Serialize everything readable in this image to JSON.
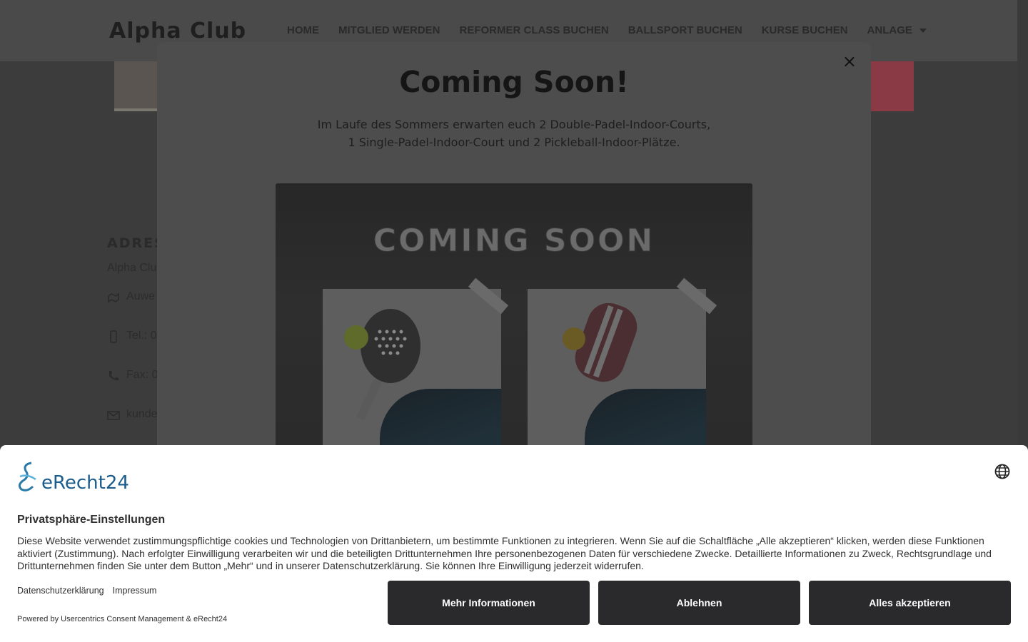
{
  "site": {
    "logo": "Alpha Club",
    "nav": [
      {
        "label": "HOME"
      },
      {
        "label": "MITGLIED WERDEN"
      },
      {
        "label": "REFORMER CLASS BUCHEN"
      },
      {
        "label": "BALLSPORT BUCHEN"
      },
      {
        "label": "KURSE BUCHEN"
      },
      {
        "label": "ANLAGE"
      }
    ],
    "address": {
      "title": "ADRES",
      "name": "Alpha Clu",
      "street": "Auwe",
      "tel": "Tel.: 0",
      "fax": "Fax: 0",
      "email": "kunde"
    }
  },
  "modal": {
    "close": "×",
    "title": "Coming Soon!",
    "text_line1": "Im Laufe des Sommers erwarten euch 2 Double-Padel-Indoor-Courts,",
    "text_line2": "1 Single-Padel-Indoor-Court und 2 Pickleball-Indoor-Plätze.",
    "promo_title": "COMING SOON"
  },
  "cookie": {
    "brand": "eRecht24",
    "heading": "Privatsphäre-Einstellungen",
    "body": "Diese Website verwendet zustimmungspflichtige cookies und Technologien von Drittanbietern, um bestimmte Funktionen zu integrieren. Wenn Sie auf die Schaltfläche „Alle akzeptieren“ klicken, werden diese Funktionen aktiviert (Zustimmung). Nach erfolgter Einwilligung verarbeiten wir und die beteiligten Drittunternehmen Ihre personenbezogenen Daten für verschiedene Zwecke. Detaillierte Informationen zu Zweck, Rechtsgrundlage und Drittunternehmen finden Sie unter dem Button „Mehr“ und in unserer Datenschutzerklärung. Sie können Ihre Einwilligung jederzeit widerrufen.",
    "link_privacy": "Datenschutzerklärung",
    "link_imprint": "Impressum",
    "powered": "Powered by Usercentrics Consent Management & eRecht24",
    "btn_more": "Mehr Informationen",
    "btn_decline": "Ablehnen",
    "btn_accept": "Alles akzeptieren"
  }
}
